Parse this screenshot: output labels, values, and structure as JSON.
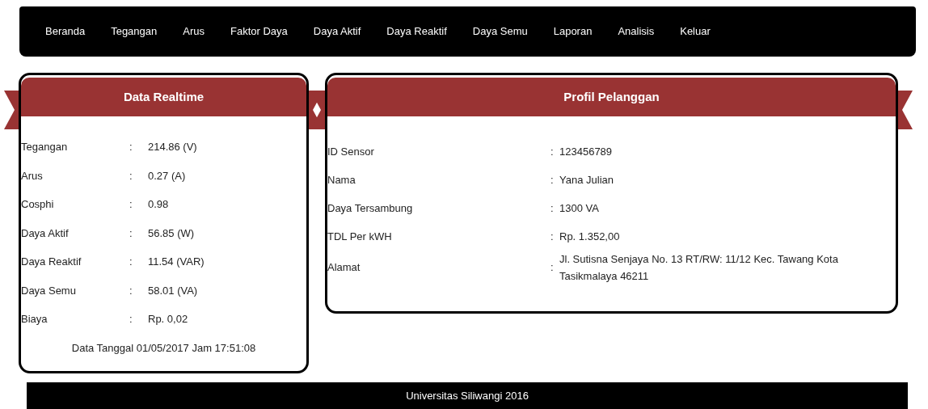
{
  "nav": [
    {
      "label": "Beranda"
    },
    {
      "label": "Tegangan"
    },
    {
      "label": "Arus"
    },
    {
      "label": "Faktor Daya"
    },
    {
      "label": "Daya Aktif"
    },
    {
      "label": "Daya Reaktif"
    },
    {
      "label": "Daya Semu"
    },
    {
      "label": "Laporan"
    },
    {
      "label": "Analisis"
    },
    {
      "label": "Keluar"
    }
  ],
  "realtime": {
    "title": "Data Realtime",
    "rows": [
      {
        "label": "Tegangan",
        "separator": ":",
        "value": "214.86 (V)"
      },
      {
        "label": "Arus",
        "separator": ":",
        "value": "0.27 (A)"
      },
      {
        "label": "Cosphi",
        "separator": ":",
        "value": "0.98"
      },
      {
        "label": "Daya Aktif",
        "separator": ":",
        "value": "56.85 (W)"
      },
      {
        "label": "Daya Reaktif",
        "separator": ":",
        "value": "11.54 (VAR)"
      },
      {
        "label": "Daya Semu",
        "separator": ":",
        "value": "58.01 (VA)"
      },
      {
        "label": "Biaya",
        "separator": ":",
        "value": "Rp. 0,02"
      }
    ],
    "timestamp": "Data Tanggal 01/05/2017 Jam 17:51:08"
  },
  "profile": {
    "title": "Profil Pelanggan",
    "rows": [
      {
        "label": "ID Sensor",
        "separator": ":",
        "value": "123456789"
      },
      {
        "label": "Nama",
        "separator": ":",
        "value": "Yana Julian"
      },
      {
        "label": "Daya Tersambung",
        "separator": ":",
        "value": "1300 VA"
      },
      {
        "label": "TDL Per kWH",
        "separator": ":",
        "value": "Rp. 1.352,00"
      },
      {
        "label": "Alamat",
        "separator": ":",
        "value": "Jl. Sutisna Senjaya No. 13 RT/RW: 11/12 Kec. Tawang Kota Tasikmalaya 46211"
      }
    ]
  },
  "footer": "Universitas Siliwangi 2016"
}
